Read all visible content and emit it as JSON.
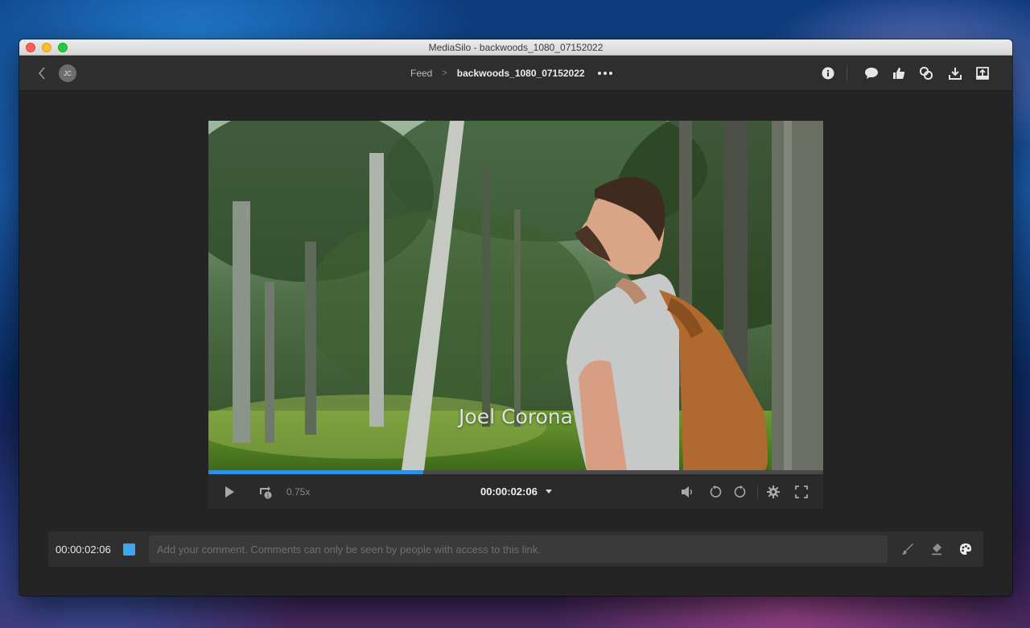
{
  "window": {
    "title": "MediaSilo - backwoods_1080_07152022"
  },
  "header": {
    "avatar_initials": "JC",
    "breadcrumb": {
      "parent": "Feed",
      "separator": ">",
      "current": "backwoods_1080_07152022"
    },
    "actions": [
      "info-icon",
      "comments-icon",
      "approve-icon",
      "link-icon",
      "download-icon",
      "upload-icon"
    ]
  },
  "player": {
    "caption": "Joel Corona",
    "progress": 0.35,
    "speed": "0.75x",
    "timecode": "00:00:02:06",
    "accent_color": "#2f8fe0"
  },
  "comment": {
    "timecode": "00:00:02:06",
    "marker_color": "#3ea6ef",
    "placeholder": "Add your comment. Comments can only be seen by people with access to this link."
  }
}
